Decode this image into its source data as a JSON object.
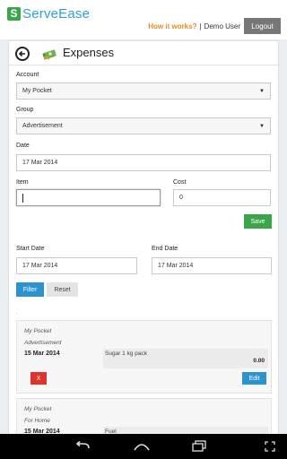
{
  "app": {
    "logo_text": "ServeEase",
    "logo_mark": "S"
  },
  "top": {
    "how_it_works": "How it works?",
    "separator": "|",
    "user": "Demo User",
    "logout": "Logout"
  },
  "page": {
    "title": "Expenses"
  },
  "form": {
    "account": {
      "label": "Account",
      "value": "My Pocket"
    },
    "group": {
      "label": "Group",
      "value": "Advertisement"
    },
    "date": {
      "label": "Date",
      "value": "17 Mar 2014"
    },
    "item": {
      "label": "Item",
      "value": ""
    },
    "cost": {
      "label": "Cost",
      "value": "0"
    },
    "save": "Save"
  },
  "filter": {
    "start_label": "Start Date",
    "start_value": "17 Mar 2014",
    "end_label": "End Date",
    "end_value": "17 Mar 2014",
    "filter_btn": "Filter",
    "reset_btn": "Reset"
  },
  "list_marker": ".",
  "entries": [
    {
      "account": "My Pocket",
      "group": "Advertisement",
      "date": "15 Mar 2014",
      "item": "Sugar 1 kg pack",
      "amount": "0.00",
      "delete": "X",
      "edit": "Edit"
    },
    {
      "account": "My Pocket",
      "group": "For Home",
      "date": "15 Mar 2014",
      "item": "Fuel"
    }
  ],
  "icons": {
    "back": "back-arrow-icon",
    "money": "money-stack-icon",
    "nav": [
      "back-nav-icon",
      "home-nav-icon",
      "recents-nav-icon",
      "screen-nav-icon"
    ]
  },
  "colors": {
    "brand_blue": "#2e9fd8",
    "brand_green": "#3aa64a",
    "link_orange": "#e88d1e",
    "save_green": "#3aa64a",
    "filter_blue": "#2a93d0",
    "delete_red": "#e0332b"
  }
}
